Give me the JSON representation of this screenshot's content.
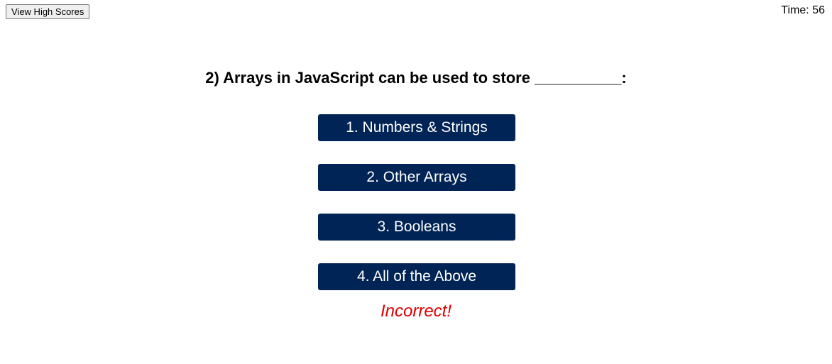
{
  "header": {
    "high_scores_label": "View High Scores",
    "timer_text": "Time: 56"
  },
  "quiz": {
    "question": "2) Arrays in JavaScript can be used to store __________:",
    "answers": [
      {
        "label": "1. Numbers & Strings"
      },
      {
        "label": "2. Other Arrays"
      },
      {
        "label": "3. Booleans"
      },
      {
        "label": "4. All of the Above"
      }
    ],
    "feedback": "Incorrect!"
  },
  "colors": {
    "answer_background": "#002455",
    "answer_text": "#ffffff",
    "feedback": "#e00000"
  }
}
